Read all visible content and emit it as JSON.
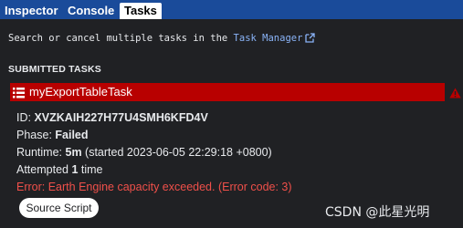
{
  "tabs": [
    {
      "label": "Inspector",
      "active": false
    },
    {
      "label": "Console",
      "active": false
    },
    {
      "label": "Tasks",
      "active": true
    }
  ],
  "intro": {
    "text": "Search or cancel multiple tasks in the ",
    "link_label": "Task Manager",
    "link_icon": "external-link-icon"
  },
  "section_title": "SUBMITTED TASKS",
  "task": {
    "name": "myExportTableTask",
    "icon": "list-icon",
    "status_icon": "warning-icon",
    "color": "#b80000",
    "id_label": "ID: ",
    "id_value": "XVZKAIH227H77U4SMH6KFD4V",
    "phase_label": "Phase: ",
    "phase_value": "Failed",
    "runtime_label": "Runtime: ",
    "runtime_value": "5m",
    "runtime_started": " (started 2023-06-05 22:29:18 +0800)",
    "attempted_prefix": "Attempted ",
    "attempted_count": "1",
    "attempted_suffix": " time",
    "error": "Error: Earth Engine capacity exceeded. (Error code: 3)",
    "source_button": "Source Script"
  },
  "watermark": "CSDN @此星光明",
  "colors": {
    "header": "#1a4b9a",
    "background": "#202124",
    "link": "#8ab4f8",
    "error": "#f0504a"
  }
}
